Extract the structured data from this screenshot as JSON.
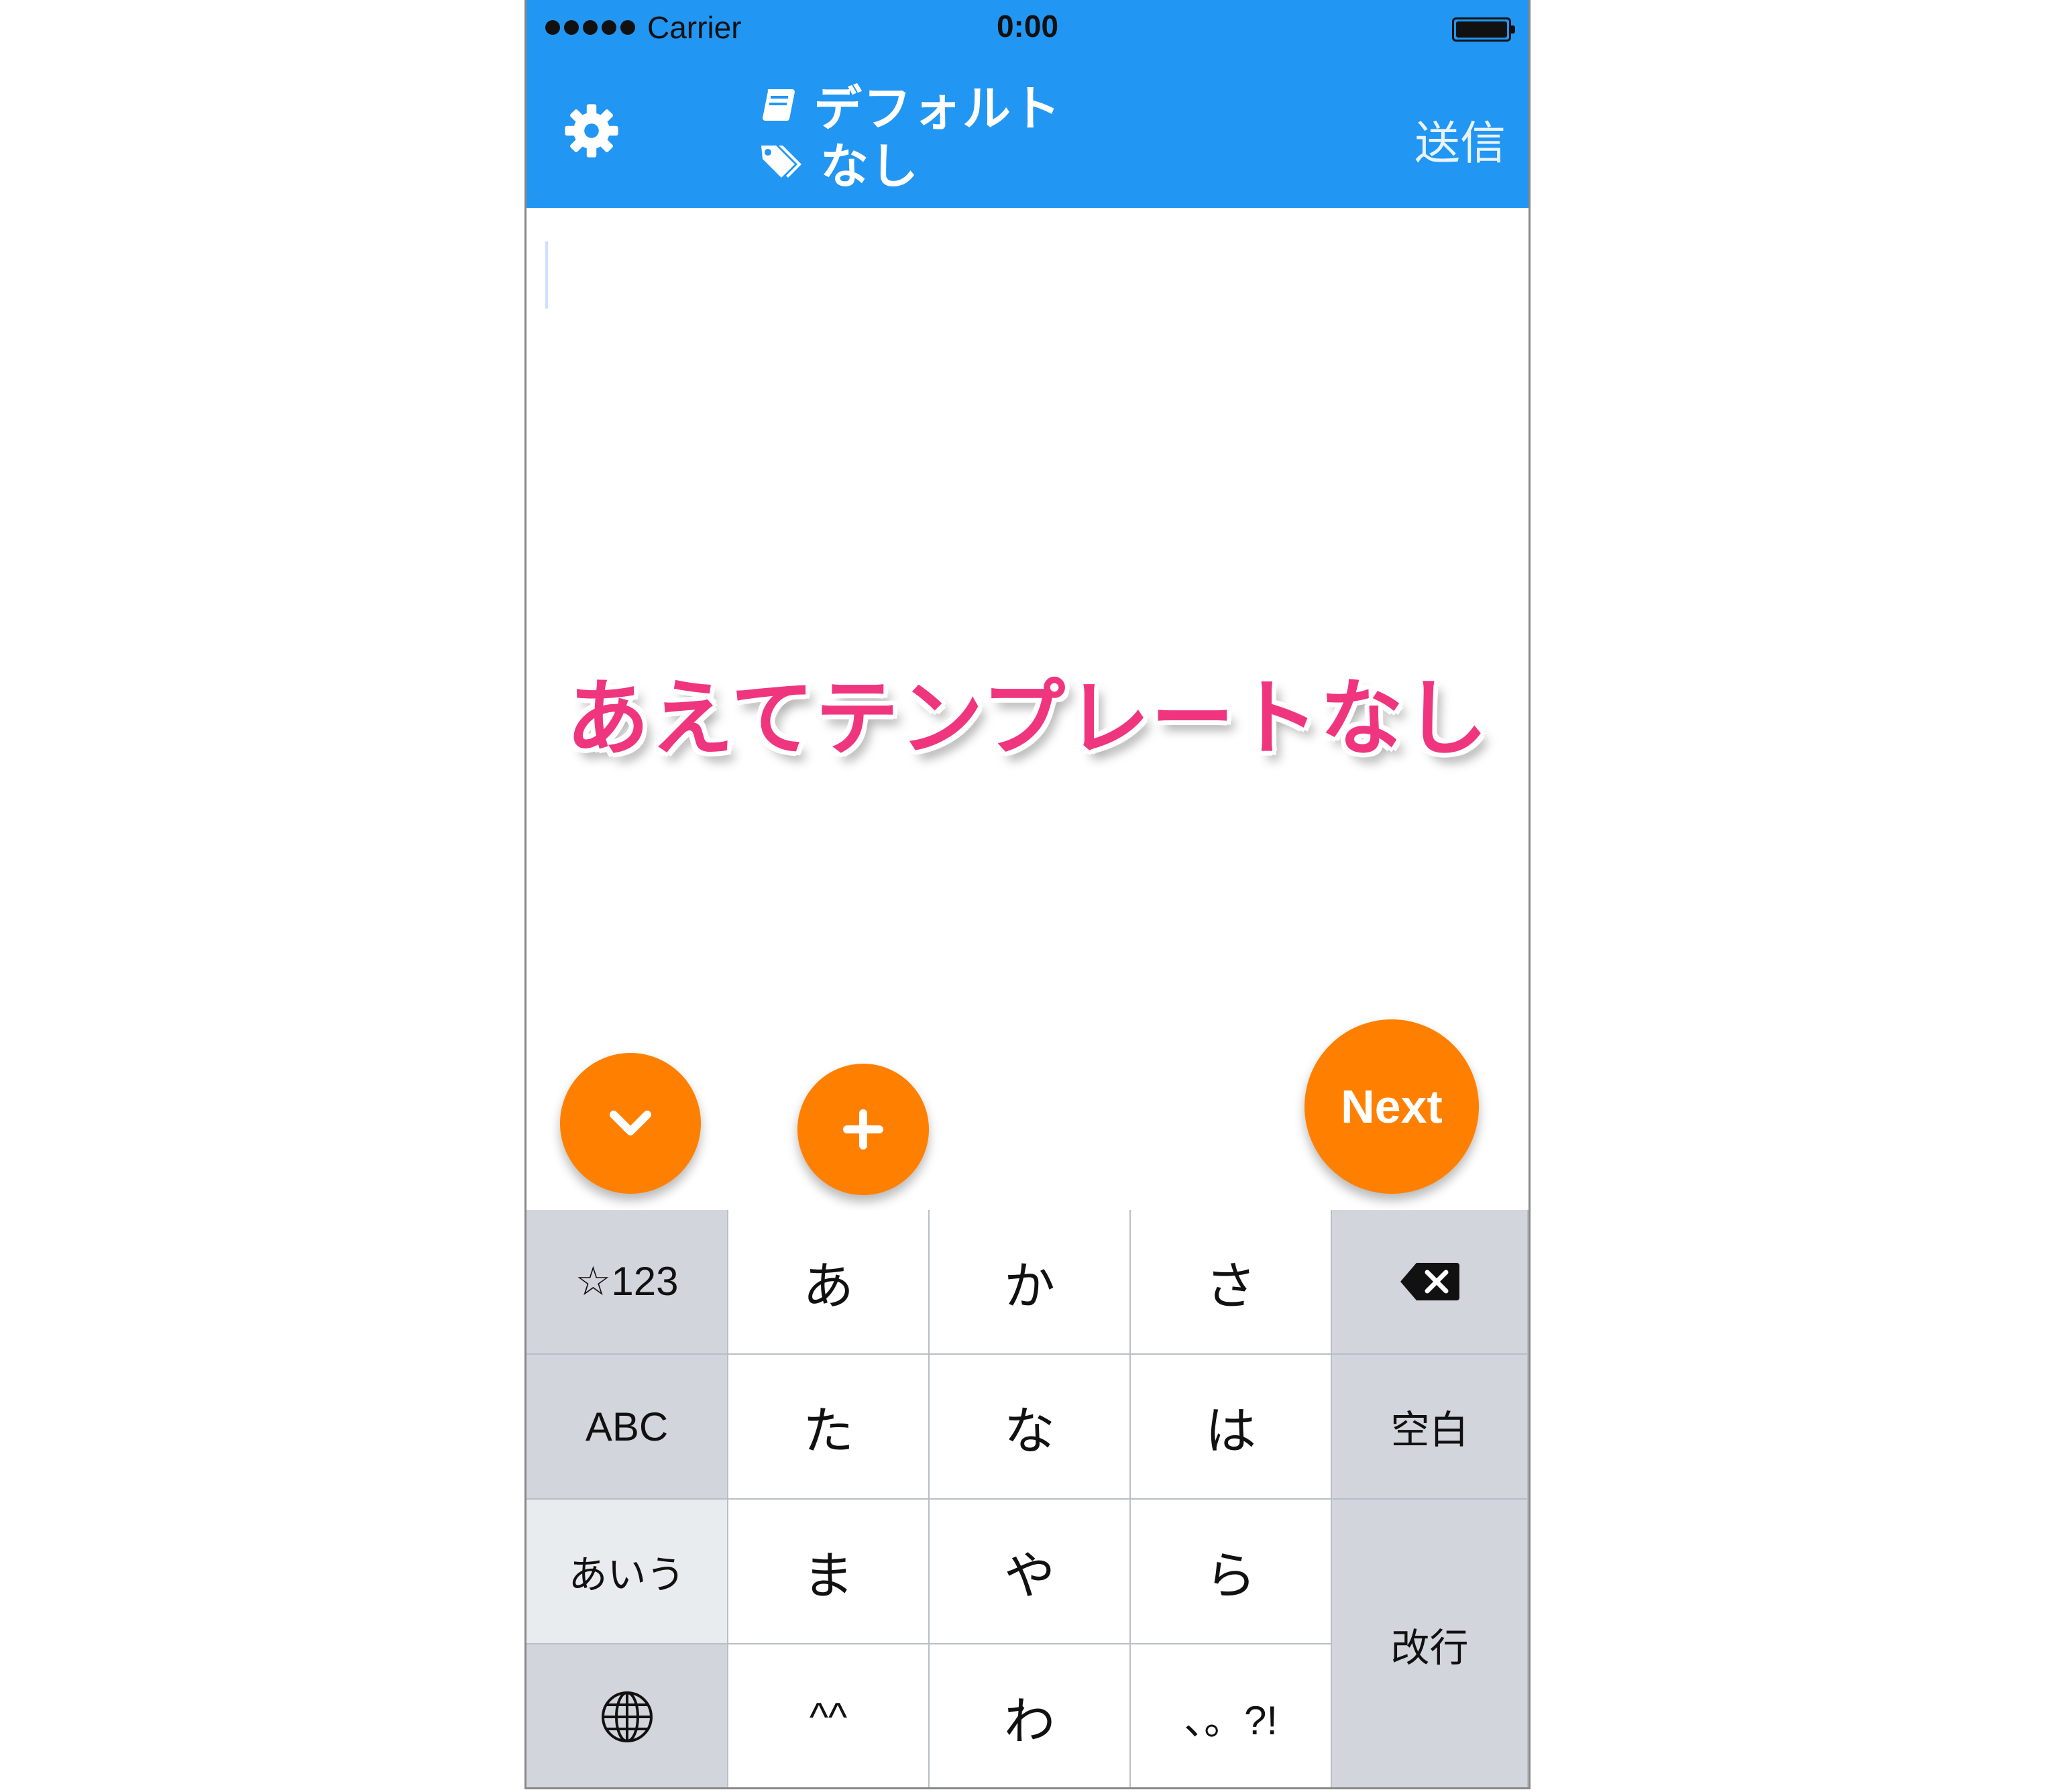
{
  "status_bar": {
    "carrier": "Carrier",
    "time": "0:00"
  },
  "nav": {
    "notebook": "デフォルト",
    "tag": "なし",
    "send_label": "送信",
    "settings_icon": "gear-icon",
    "notebook_icon": "book-icon",
    "tag_icon": "tag-icon"
  },
  "editor": {
    "annotation": "あえてテンプレートなし"
  },
  "fabs": {
    "down_icon": "chevron-down-icon",
    "plus_icon": "plus-icon",
    "next_label": "Next"
  },
  "keyboard": {
    "row1": [
      "☆123",
      "あ",
      "か",
      "さ"
    ],
    "row2": [
      "ABC",
      "た",
      "な",
      "は",
      "空白"
    ],
    "row3": [
      "あいう",
      "ま",
      "や",
      "ら"
    ],
    "row4": [
      "",
      "^^",
      "わ",
      "、。?!"
    ],
    "enter": "改行",
    "delete_icon": "backspace-icon",
    "globe_icon": "globe-icon"
  },
  "colors": {
    "nav_blue": "#2196f3",
    "fab_orange": "#ff8000",
    "annotation_pink": "#f0357f"
  }
}
